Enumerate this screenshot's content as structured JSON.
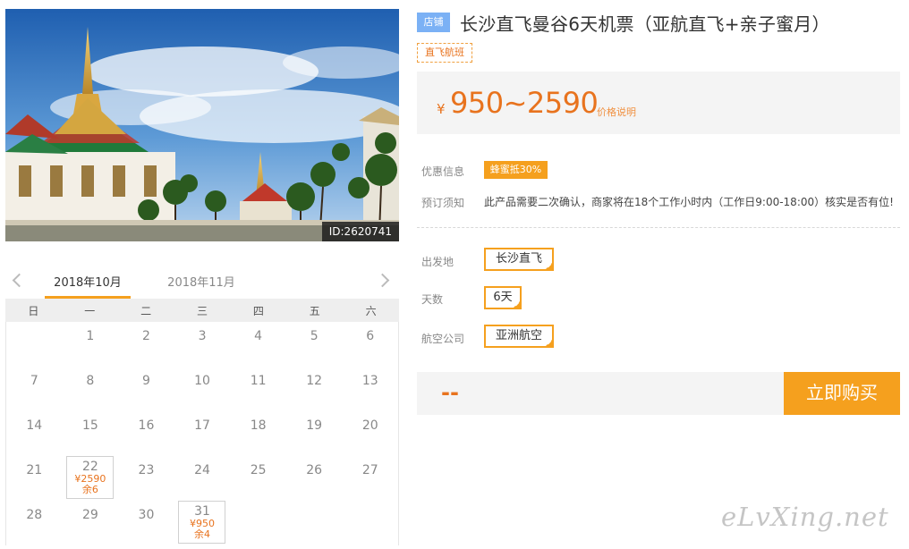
{
  "hero": {
    "id_badge": "ID:2620741"
  },
  "calendar": {
    "months": [
      "2018年10月",
      "2018年11月"
    ],
    "active_month_index": 0,
    "weekdays": [
      "日",
      "一",
      "二",
      "三",
      "四",
      "五",
      "六"
    ],
    "weeks": [
      [
        {
          "d": ""
        },
        {
          "d": "1"
        },
        {
          "d": "2"
        },
        {
          "d": "3"
        },
        {
          "d": "4"
        },
        {
          "d": "5"
        },
        {
          "d": "6"
        }
      ],
      [
        {
          "d": "7"
        },
        {
          "d": "8"
        },
        {
          "d": "9"
        },
        {
          "d": "10"
        },
        {
          "d": "11"
        },
        {
          "d": "12"
        },
        {
          "d": "13"
        }
      ],
      [
        {
          "d": "14"
        },
        {
          "d": "15"
        },
        {
          "d": "16"
        },
        {
          "d": "17"
        },
        {
          "d": "18"
        },
        {
          "d": "19"
        },
        {
          "d": "20"
        }
      ],
      [
        {
          "d": "21"
        },
        {
          "d": "22",
          "price": "¥2590",
          "remain": "余6"
        },
        {
          "d": "23"
        },
        {
          "d": "24"
        },
        {
          "d": "25"
        },
        {
          "d": "26"
        },
        {
          "d": "27"
        }
      ],
      [
        {
          "d": "28"
        },
        {
          "d": "29"
        },
        {
          "d": "30"
        },
        {
          "d": "31",
          "price": "¥950",
          "remain": "余4"
        },
        {
          "d": ""
        },
        {
          "d": ""
        },
        {
          "d": ""
        }
      ]
    ]
  },
  "product": {
    "store_tag": "店铺",
    "title": "长沙直飞曼谷6天机票（亚航直飞+亲子蜜月）",
    "direct_tag": "直飞航班",
    "currency": "¥",
    "price_range": "950~2590",
    "price_note": "价格说明"
  },
  "info": {
    "promo_label": "优惠信息",
    "promo_badge": "蜂蜜抵30%",
    "notice_label": "预订须知",
    "notice_text": "此产品需要二次确认，商家将在18个工作小时内（工作日9:00-18:00）核实是否有位!"
  },
  "options": {
    "departure_label": "出发地",
    "departure_value": "长沙直飞",
    "days_label": "天数",
    "days_value": "6天",
    "airline_label": "航空公司",
    "airline_value": "亚洲航空"
  },
  "purchase": {
    "quantity_display": "--",
    "buy_label": "立即购买"
  },
  "watermark": "eLvXing.net",
  "colors": {
    "accent": "#f5a01e",
    "price": "#e8731e",
    "store_tag": "#7bb1f5"
  }
}
